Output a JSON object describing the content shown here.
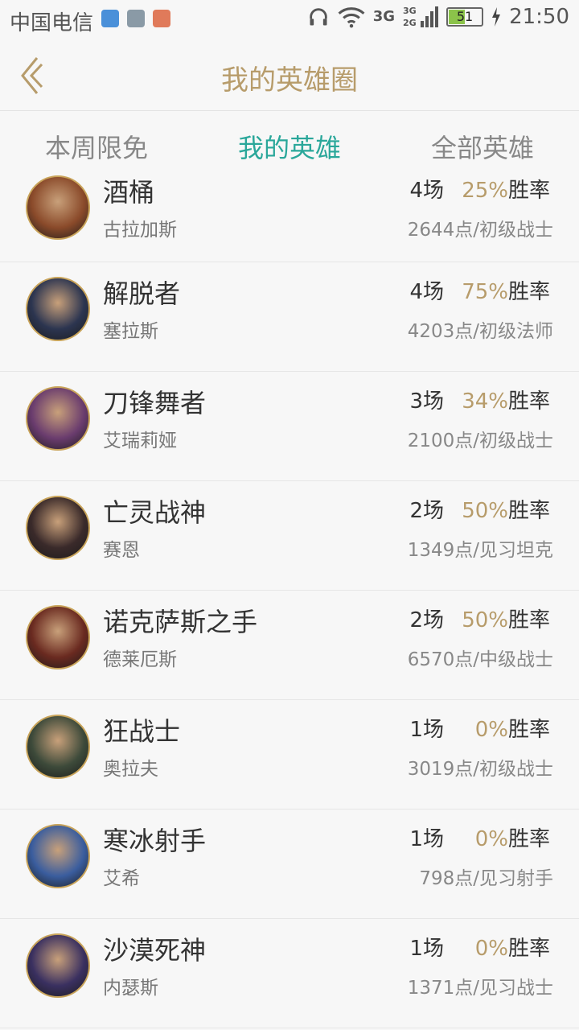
{
  "status_bar": {
    "carrier": "中国电信",
    "network_top": "3G",
    "network_sub": "3G\n2G",
    "battery": "51",
    "time": "21:50"
  },
  "header": {
    "title": "我的英雄圈"
  },
  "tabs": [
    {
      "label": "本周限免",
      "active": false
    },
    {
      "label": "我的英雄",
      "active": true
    },
    {
      "label": "全部英雄",
      "active": false
    }
  ],
  "colors": {
    "accent": "#2aa79a",
    "gold": "#b79c6b"
  },
  "heroes": [
    {
      "name": "酒桶",
      "sub": "古拉加斯",
      "games": "4场",
      "rate_pct": "25%",
      "rate_label": "胜率",
      "points": "2644点/初级战士",
      "avatar_color": "#8a4a2a"
    },
    {
      "name": "解脱者",
      "sub": "塞拉斯",
      "games": "4场",
      "rate_pct": "75%",
      "rate_label": "胜率",
      "points": "4203点/初级法师",
      "avatar_color": "#2c3550"
    },
    {
      "name": "刀锋舞者",
      "sub": "艾瑞莉娅",
      "games": "3场",
      "rate_pct": "34%",
      "rate_label": "胜率",
      "points": "2100点/初级战士",
      "avatar_color": "#6a3c6e"
    },
    {
      "name": "亡灵战神",
      "sub": "赛恩",
      "games": "2场",
      "rate_pct": "50%",
      "rate_label": "胜率",
      "points": "1349点/见习坦克",
      "avatar_color": "#3a2a2a"
    },
    {
      "name": "诺克萨斯之手",
      "sub": "德莱厄斯",
      "games": "2场",
      "rate_pct": "50%",
      "rate_label": "胜率",
      "points": "6570点/中级战士",
      "avatar_color": "#6a2a20"
    },
    {
      "name": "狂战士",
      "sub": "奥拉夫",
      "games": "1场",
      "rate_pct": "0%",
      "rate_label": "胜率",
      "points": "3019点/初级战士",
      "avatar_color": "#3d4a3a"
    },
    {
      "name": "寒冰射手",
      "sub": "艾希",
      "games": "1场",
      "rate_pct": "0%",
      "rate_label": "胜率",
      "points": "798点/见习射手",
      "avatar_color": "#3a5d9e"
    },
    {
      "name": "沙漠死神",
      "sub": "内瑟斯",
      "games": "1场",
      "rate_pct": "0%",
      "rate_label": "胜率",
      "points": "1371点/见习战士",
      "avatar_color": "#3a3060"
    }
  ]
}
